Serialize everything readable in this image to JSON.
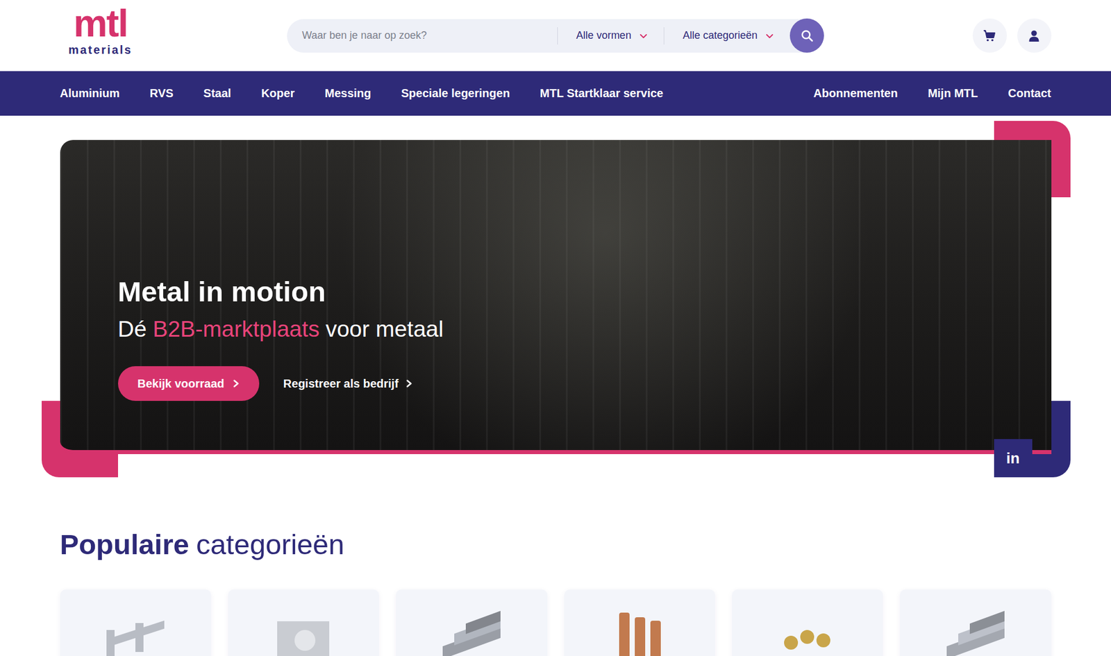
{
  "logo": {
    "mark": "mtl",
    "sub": "materials"
  },
  "search": {
    "placeholder": "Waar ben je naar op zoek?",
    "filters": [
      "Alle vormen",
      "Alle categorieën"
    ]
  },
  "nav": {
    "main": [
      "Aluminium",
      "RVS",
      "Staal",
      "Koper",
      "Messing",
      "Speciale legeringen",
      "MTL Startklaar service"
    ],
    "secondary": [
      "Abonnementen",
      "Mijn MTL",
      "Contact"
    ]
  },
  "hero": {
    "title": "Metal in motion",
    "subtitle_before": "Dé",
    "subtitle_highlight": "B2B-marktplaats",
    "subtitle_after": "voor metaal",
    "primary": "Bekijk voorraad",
    "secondary": "Registreer als bedrijf",
    "social": "in"
  },
  "section": {
    "title_bold": "Populaire",
    "title_rest": "categorieën",
    "cards": [
      {
        "kind": "profile",
        "color": "#b8bcc4"
      },
      {
        "kind": "block",
        "color": "#c9ccd2"
      },
      {
        "kind": "bar",
        "color": "#9a9ea6"
      },
      {
        "kind": "tube",
        "color": "#c27a4e"
      },
      {
        "kind": "rod",
        "color": "#c9a54a"
      },
      {
        "kind": "bar",
        "color": "#a4a8b0"
      }
    ]
  }
}
